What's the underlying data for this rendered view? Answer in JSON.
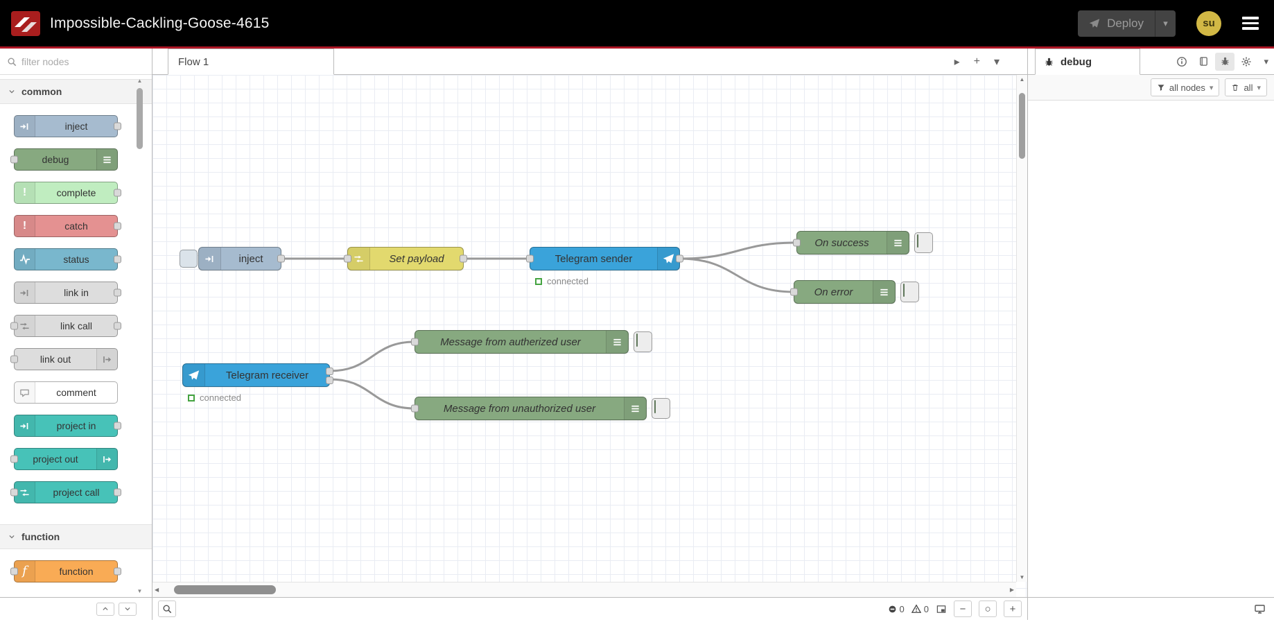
{
  "colors": {
    "accent-red": "#ad1625",
    "header-bg": "#000000",
    "avatar-bg": "#d2b845",
    "grid": "#e9ecf3",
    "wire": "#999999",
    "status-green": "#44a340",
    "node-inject": "#a6bbcf",
    "node-debug": "#87a980",
    "node-complete": "#c0edc0",
    "node-catch": "#e49191",
    "node-status": "#79b7cd",
    "node-link": "#dddddd",
    "node-comment": "#ffffff",
    "node-project": "#47c2b8",
    "node-function": "#f9ab55",
    "node-change": "#e2d96e",
    "node-telegram": "#3aa3da"
  },
  "header": {
    "title": "Impossible-Cackling-Goose-4615",
    "deploy_label": "Deploy",
    "user_initials": "su"
  },
  "palette": {
    "filter_placeholder": "filter nodes",
    "categories": [
      {
        "label": "common",
        "nodes": [
          {
            "label": "inject"
          },
          {
            "label": "debug"
          },
          {
            "label": "complete"
          },
          {
            "label": "catch"
          },
          {
            "label": "status"
          },
          {
            "label": "link in"
          },
          {
            "label": "link call"
          },
          {
            "label": "link out"
          },
          {
            "label": "comment"
          },
          {
            "label": "project in"
          },
          {
            "label": "project out"
          },
          {
            "label": "project call"
          }
        ]
      },
      {
        "label": "function",
        "nodes": [
          {
            "label": "function"
          }
        ]
      }
    ]
  },
  "workspace": {
    "tab_label": "Flow 1",
    "nodes": {
      "inject": {
        "label": "inject"
      },
      "set_payload": {
        "label": "Set payload"
      },
      "telegram_sender": {
        "label": "Telegram sender",
        "status": "connected"
      },
      "on_success": {
        "label": "On success"
      },
      "on_error": {
        "label": "On error"
      },
      "telegram_receiver": {
        "label": "Telegram receiver",
        "status": "connected"
      },
      "msg_authorized": {
        "label": "Message from autherized user"
      },
      "msg_unauthorized": {
        "label": "Message from unauthorized user"
      }
    },
    "footer": {
      "error_count": "0",
      "warning_count": "0"
    }
  },
  "sidebar": {
    "tab_label": "debug",
    "filter_label": "all nodes",
    "clear_label": "all"
  },
  "icons": {
    "caret": "▾",
    "plus": "+",
    "minus": "−",
    "zoom_reset": "○",
    "tab_scroll": "▸",
    "arrow_up": "▲",
    "arrow_down": "▼",
    "arrow_left": "◀",
    "arrow_right": "▶",
    "exclaim": "!",
    "function_glyph": "f"
  }
}
